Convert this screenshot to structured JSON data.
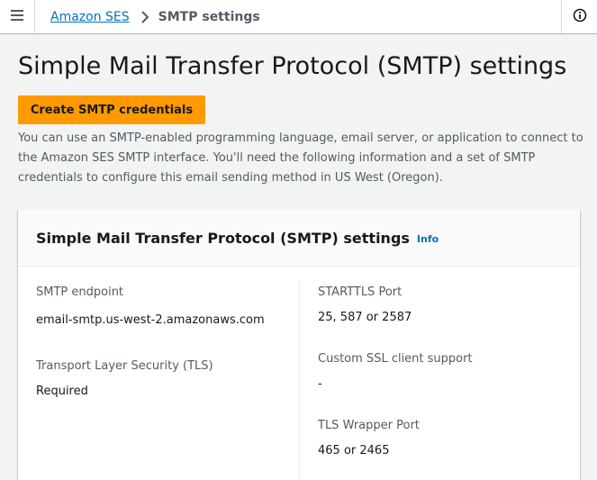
{
  "breadcrumb": {
    "parent": "Amazon SES",
    "current": "SMTP settings"
  },
  "page": {
    "title": "Simple Mail Transfer Protocol (SMTP) settings",
    "create_button": "Create SMTP credentials",
    "description": "You can use an SMTP-enabled programming language, email server, or application to connect to the Amazon SES SMTP interface. You'll need the following information and a set of SMTP credentials to configure this email sending method in US West (Oregon)."
  },
  "panel": {
    "title": "Simple Mail Transfer Protocol (SMTP) settings",
    "info_link": "Info",
    "fields": {
      "smtp_endpoint": {
        "label": "SMTP endpoint",
        "value": "email-smtp.us-west-2.amazonaws.com"
      },
      "tls": {
        "label": "Transport Layer Security (TLS)",
        "value": "Required"
      },
      "starttls_port": {
        "label": "STARTTLS Port",
        "value": "25, 587 or 2587"
      },
      "custom_ssl": {
        "label": "Custom SSL client support",
        "value": "-"
      },
      "tls_wrapper_port": {
        "label": "TLS Wrapper Port",
        "value": "465 or 2465"
      }
    }
  },
  "icons": {
    "menu": "hamburger-menu-icon",
    "breadcrumb_separator": "chevron-right-icon",
    "info": "info-circle-icon"
  },
  "colors": {
    "primary_button": "#ff9900",
    "link": "#0073bb",
    "background": "#f2f3f3"
  }
}
